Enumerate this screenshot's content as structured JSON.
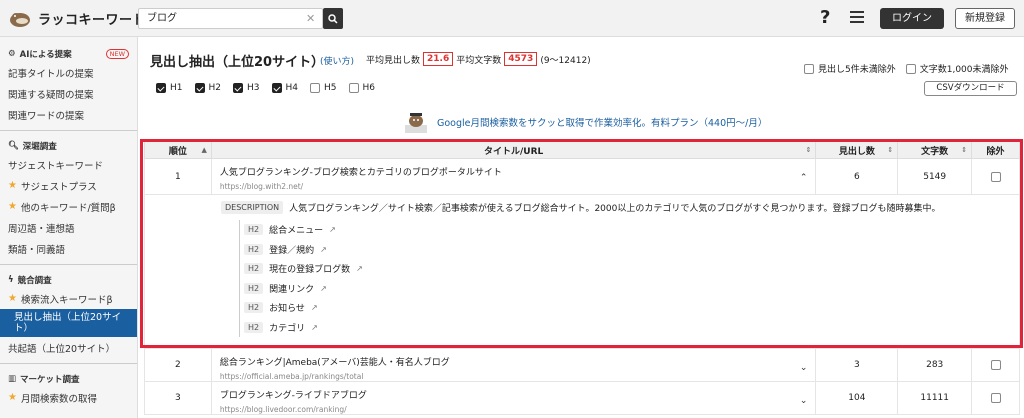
{
  "header": {
    "logo_text": "ラッコキーワード",
    "search_value": "ブログ",
    "help": "?",
    "login_label": "ログイン",
    "signup_label": "新規登録"
  },
  "sidebar": {
    "ai_section": {
      "title": "AIによる提案",
      "badge": "NEW",
      "items": [
        "記事タイトルの提案",
        "関連する疑問の提案",
        "関連ワードの提案"
      ]
    },
    "deep_section": {
      "title": "深堀調査",
      "items": [
        "サジェストキーワード",
        "サジェストプラス",
        "他のキーワード/質問β",
        "周辺語・連想語",
        "類語・同義語"
      ]
    },
    "competitor_section": {
      "title": "競合調査",
      "items": [
        "検索流入キーワードβ",
        "見出し抽出（上位20サイト）",
        "共起語（上位20サイト）"
      ]
    },
    "market_section": {
      "title": "マーケット調査",
      "items": [
        "月間検索数の取得"
      ]
    }
  },
  "main": {
    "title": "見出し抽出（上位20サイト）",
    "howto": "(使い方)",
    "avg_headings_label": "平均見出し数",
    "avg_headings_value": "21.6",
    "avg_chars_label": "平均文字数",
    "avg_chars_value": "4573",
    "range": "(9〜12412)",
    "filters": [
      "H1",
      "H2",
      "H3",
      "H4",
      "H5",
      "H6"
    ],
    "filters_checked": [
      true,
      true,
      true,
      true,
      false,
      false
    ],
    "exclude_headings": "見出し5件未満除外",
    "exclude_chars": "文字数1,000未満除外",
    "csv_label": "CSVダウンロード",
    "promo": "Google月間検索数をサクッと取得で作業効率化。有料プラン（440円〜/月）"
  },
  "table": {
    "headers": [
      "順位",
      "タイトル/URL",
      "見出し数",
      "文字数",
      "除外"
    ],
    "rows": [
      {
        "rank": "1",
        "title": "人気ブログランキング-ブログ検索とカテゴリのブログポータルサイト",
        "url": "https://blog.with2.net/",
        "headings": "6",
        "chars": "5149",
        "description_tag": "DESCRIPTION",
        "description": "人気ブログランキング／サイト検索／記事検索が使えるブログ総合サイト。2000以上のカテゴリで人気のブログがすぐ見つかります。登録ブログも随時募集中。",
        "h_items": [
          {
            "tag": "H2",
            "text": "総合メニュー"
          },
          {
            "tag": "H2",
            "text": "登録／規約"
          },
          {
            "tag": "H2",
            "text": "現在の登録ブログ数"
          },
          {
            "tag": "H2",
            "text": "関連リンク"
          },
          {
            "tag": "H2",
            "text": "お知らせ"
          },
          {
            "tag": "H2",
            "text": "カテゴリ"
          }
        ]
      },
      {
        "rank": "2",
        "title": "総合ランキング|Ameba(アメーバ)芸能人・有名人ブログ",
        "url": "https://official.ameba.jp/rankings/total",
        "headings": "3",
        "chars": "283"
      },
      {
        "rank": "3",
        "title": "ブログランキング-ライブドアブログ",
        "url": "https://blog.livedoor.com/ranking/",
        "headings": "104",
        "chars": "11111"
      }
    ]
  },
  "colors": {
    "accent": "#1a5fa0",
    "highlight": "#e0243a",
    "badge": "#d33"
  }
}
